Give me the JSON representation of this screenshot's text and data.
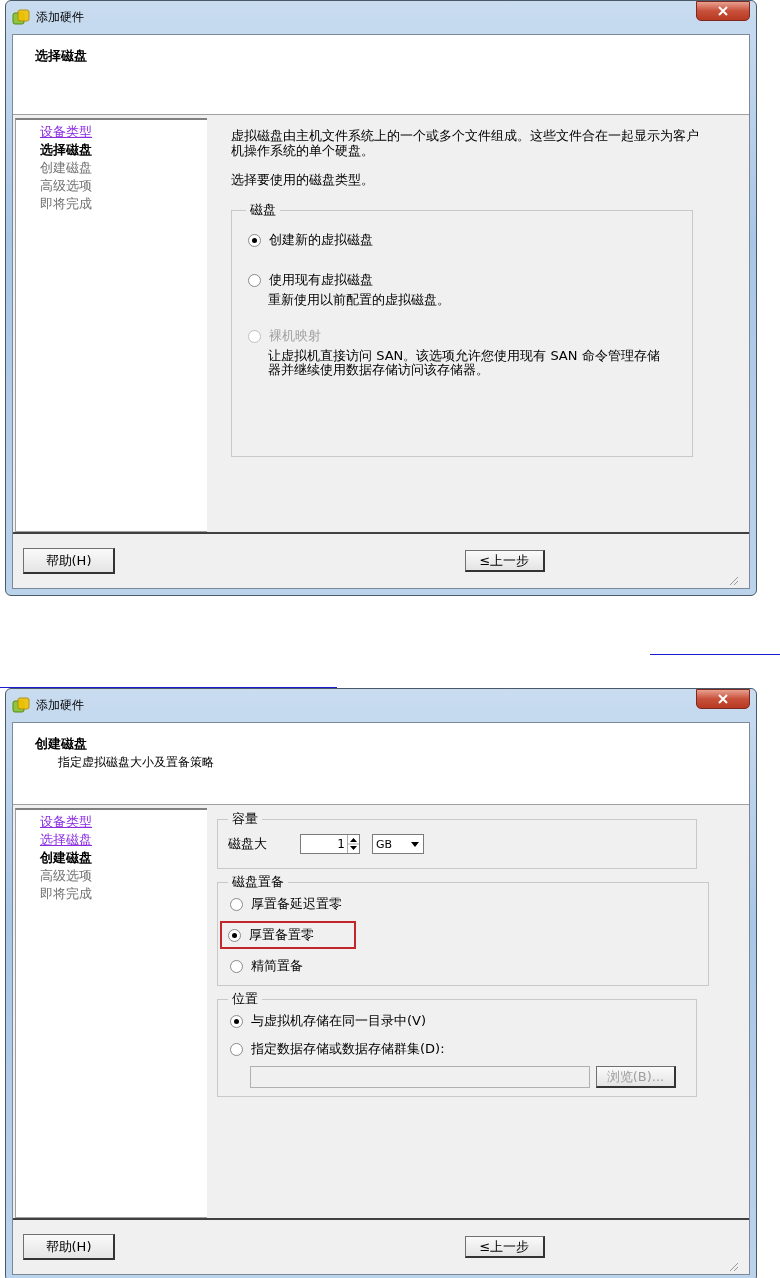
{
  "dialogs": [
    {
      "title": "添加硬件",
      "header": {
        "title": "选择磁盘"
      },
      "nav": [
        {
          "label": "设备类型",
          "selected": false,
          "visited": true
        },
        {
          "label": "选择磁盘",
          "selected": true,
          "visited": false
        },
        {
          "label": "创建磁盘",
          "selected": false,
          "visited": false
        },
        {
          "label": "高级选项",
          "selected": false,
          "visited": false
        },
        {
          "label": "即将完成",
          "selected": false,
          "visited": false
        }
      ],
      "content": [
        {
          "kind": "text",
          "text": "虚拟磁盘由主机文件系统上的一个或多个文件组成。这些文件合在一起显示为客户机操作系统的单个硬盘。"
        },
        {
          "kind": "text",
          "text": "选择要使用的磁盘类型。"
        },
        {
          "kind": "group",
          "title": "磁盘",
          "items": [
            {
              "kind": "radio",
              "label": "创建新的虚拟磁盘",
              "selected": true,
              "disabled": false
            },
            {
              "kind": "radio",
              "label": "使用现有虚拟磁盘",
              "selected": false,
              "disabled": false,
              "description": "重新使用以前配置的虚拟磁盘。"
            },
            {
              "kind": "radio",
              "label": "裸机映射",
              "selected": false,
              "disabled": true,
              "description": "让虚拟机直接访问 SAN。该选项允许您使用现有 SAN 命令管理存储器并继续使用数据存储访问该存储器。"
            }
          ]
        }
      ],
      "buttons": [
        {
          "label": "帮助(H)",
          "kind": "help"
        },
        {
          "label": "≤上一步",
          "kind": "back"
        }
      ]
    },
    {
      "title": "添加硬件",
      "header": {
        "title": "创建磁盘",
        "subtitle": "指定虚拟磁盘大小及置备策略"
      },
      "nav": [
        {
          "label": "设备类型",
          "selected": false,
          "visited": true
        },
        {
          "label": "选择磁盘",
          "selected": false,
          "visited": true
        },
        {
          "label": "创建磁盘",
          "selected": true,
          "visited": false
        },
        {
          "label": "高级选项",
          "selected": false,
          "visited": false
        },
        {
          "label": "即将完成",
          "selected": false,
          "visited": false
        }
      ],
      "content": [
        {
          "kind": "group",
          "title": "容量",
          "items": [
            {
              "kind": "size",
              "label": "磁盘大",
              "value": "1",
              "unit": "GB"
            }
          ]
        },
        {
          "kind": "group",
          "title": "磁盘置备",
          "items": [
            {
              "kind": "radio",
              "label": "厚置备延迟置零",
              "selected": false,
              "disabled": false
            },
            {
              "kind": "radio",
              "label": "厚置备置零",
              "selected": true,
              "disabled": false,
              "highlighted": true
            },
            {
              "kind": "radio",
              "label": "精简置备",
              "selected": false,
              "disabled": false
            }
          ]
        },
        {
          "kind": "group",
          "title": "位置",
          "items": [
            {
              "kind": "radio",
              "label": "与虚拟机存储在同一目录中(V)",
              "selected": true,
              "disabled": false
            },
            {
              "kind": "radio",
              "label": "指定数据存储或数据存储群集(D):",
              "selected": false,
              "disabled": false
            },
            {
              "kind": "path",
              "button": "浏览(B)...",
              "disabled": true
            }
          ]
        }
      ],
      "buttons": [
        {
          "label": "帮助(H)",
          "kind": "help"
        },
        {
          "label": "≤上一步",
          "kind": "back"
        }
      ]
    }
  ]
}
